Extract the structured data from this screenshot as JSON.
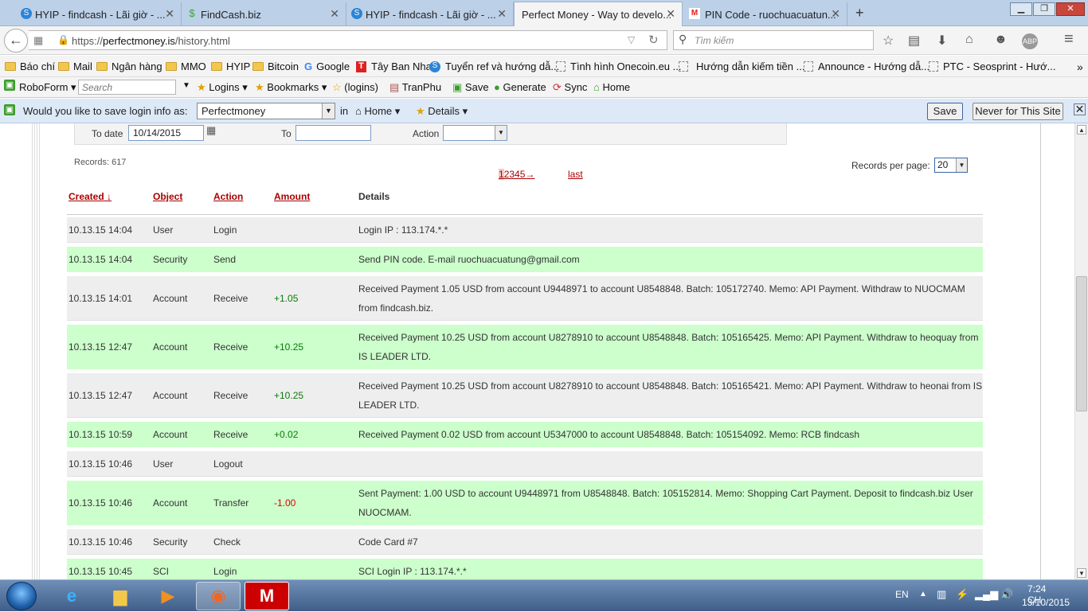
{
  "browser": {
    "tabs": [
      {
        "label": "HYIP - findcash - Lãi giờ - ...",
        "icon": "s-circle-icon"
      },
      {
        "label": "FindCash.biz",
        "icon": "dollar-icon"
      },
      {
        "label": "HYIP - findcash - Lãi giờ - ...",
        "icon": "s-circle-icon"
      },
      {
        "label": "Perfect Money - Way to develo...",
        "icon": "none"
      },
      {
        "label": "PIN Code - ruochuacuatun...",
        "icon": "gmail-icon"
      }
    ],
    "url_prefix": "https://",
    "url_host": "perfectmoney.is",
    "url_path": "/history.html",
    "search_placeholder": "Tìm kiếm",
    "abp_label": "ABP"
  },
  "bookmarks": [
    {
      "label": "Báo chí",
      "icon": "folder"
    },
    {
      "label": "Mail",
      "icon": "folder"
    },
    {
      "label": "Ngân hàng",
      "icon": "folder"
    },
    {
      "label": "MMO",
      "icon": "folder"
    },
    {
      "label": "HYIP",
      "icon": "folder"
    },
    {
      "label": "Bitcoin",
      "icon": "folder"
    },
    {
      "label": "Google",
      "icon": "google-icon"
    },
    {
      "label": "Tây Ban Nha",
      "icon": "t-icon"
    },
    {
      "label": "Tuyển ref và hướng dẫ...",
      "icon": "s-circle-icon"
    },
    {
      "label": "Tình hình Onecoin.eu ...",
      "icon": "page"
    },
    {
      "label": "Hướng dẫn kiếm tiền ...",
      "icon": "page"
    },
    {
      "label": "Announce - Hướng dẫ...",
      "icon": "page"
    },
    {
      "label": "PTC - Seosprint - Hướ...",
      "icon": "page"
    }
  ],
  "roboform": {
    "brand": "RoboForm",
    "search_placeholder": "Search",
    "items": [
      "Logins",
      "Bookmarks",
      "(logins)",
      "TranPhu",
      "Save",
      "Generate",
      "Sync",
      "Home"
    ]
  },
  "save_login": {
    "question": "Would you like to save login info as:",
    "selected": "Perfectmoney",
    "in_label": "in",
    "folder": "Home",
    "details": "Details",
    "save_btn": "Save",
    "never_btn": "Never for This Site"
  },
  "filters": {
    "to_date_label": "To date",
    "to_date_value": "10/14/2015",
    "to_label": "To",
    "to_value": "",
    "action_label": "Action",
    "action_value": ""
  },
  "records_text": "Records: 617",
  "pagination": {
    "current": "1",
    "pages": "2345",
    "next_arrow": "→",
    "last": "last"
  },
  "records_per_page": {
    "label": "Records per page:",
    "value": "20"
  },
  "columns": {
    "created": "Created",
    "sort_indicator": "↓",
    "object": "Object",
    "action": "Action",
    "amount": "Amount",
    "details": "Details"
  },
  "rows": [
    {
      "created": "10.13.15 14:04",
      "object": "User",
      "action": "Login",
      "amount": "",
      "details": "Login IP : 113.174.*.*",
      "style": "gray"
    },
    {
      "created": "10.13.15 14:04",
      "object": "Security",
      "action": "Send",
      "amount": "",
      "details": "Send PIN code. E-mail ruochuacuatung@gmail.com",
      "style": "green"
    },
    {
      "created": "10.13.15 14:01",
      "object": "Account",
      "action": "Receive",
      "amount": "+1.05",
      "details": "Received Payment 1.05 USD from account U9448971 to account U8548848. Batch: 105172740. Memo: API Payment. Withdraw to NUOCMAM from findcash.biz.",
      "style": "gray"
    },
    {
      "created": "10.13.15 12:47",
      "object": "Account",
      "action": "Receive",
      "amount": "+10.25",
      "details": "Received Payment 10.25 USD from account U8278910 to account U8548848. Batch: 105165425. Memo: API Payment. Withdraw to heoquay from IS LEADER LTD.",
      "style": "green"
    },
    {
      "created": "10.13.15 12:47",
      "object": "Account",
      "action": "Receive",
      "amount": "+10.25",
      "details": "Received Payment 10.25 USD from account U8278910 to account U8548848. Batch: 105165421. Memo: API Payment. Withdraw to heonai from IS LEADER LTD.",
      "style": "gray"
    },
    {
      "created": "10.13.15 10:59",
      "object": "Account",
      "action": "Receive",
      "amount": "+0.02",
      "details": "Received Payment 0.02 USD from account U5347000 to account U8548848. Batch: 105154092. Memo: RCB findcash",
      "style": "green"
    },
    {
      "created": "10.13.15 10:46",
      "object": "User",
      "action": "Logout",
      "amount": "",
      "details": "",
      "style": "gray"
    },
    {
      "created": "10.13.15 10:46",
      "object": "Account",
      "action": "Transfer",
      "amount": "-1.00",
      "details": "Sent Payment: 1.00 USD to account U9448971 from U8548848. Batch: 105152814. Memo: Shopping Cart Payment. Deposit to findcash.biz User NUOCMAM.",
      "style": "green"
    },
    {
      "created": "10.13.15 10:46",
      "object": "Security",
      "action": "Check",
      "amount": "",
      "details": "Code Card #7",
      "style": "gray"
    },
    {
      "created": "10.13.15 10:45",
      "object": "SCI",
      "action": "Login",
      "amount": "",
      "details": "SCI Login IP : 113.174.*.*",
      "style": "green"
    }
  ],
  "taskbar": {
    "lang": "EN",
    "time": "7:24 CH",
    "date": "13/10/2015"
  }
}
